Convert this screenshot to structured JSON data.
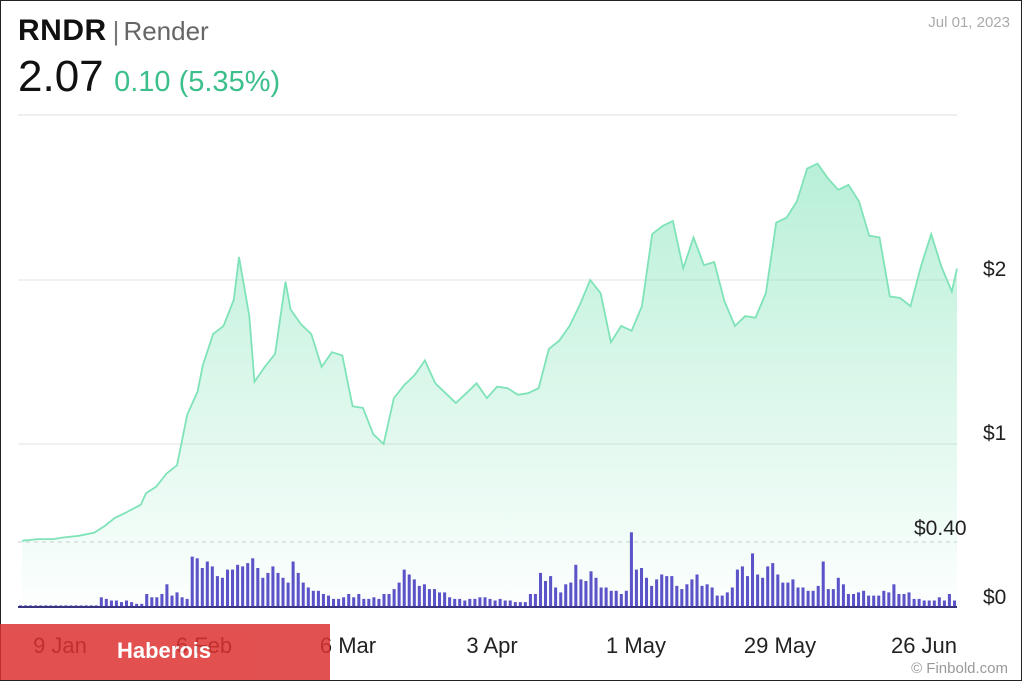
{
  "header": {
    "ticker": "RNDR",
    "separator": "|",
    "name": "Render",
    "price": "2.07",
    "change": "0.10 (5.35%)",
    "date": "Jul 01, 2023"
  },
  "colors": {
    "line": "#7fe3b8",
    "positive_text": "#3cbf8a",
    "volume_bar": "#5b53c8",
    "gridline": "#e3e3e3",
    "watermark": "#dd3232"
  },
  "watermark": "Haberois",
  "credit": "© Finbold.com",
  "chart_data": {
    "type": "area",
    "x_ticks": [
      "9 Jan",
      "6 Feb",
      "6 Mar",
      "3 Apr",
      "1 May",
      "29 May",
      "26 Jun"
    ],
    "price_axis": {
      "ticks": [
        "$2",
        "$1"
      ],
      "tick_values": [
        2,
        1
      ],
      "ylim": [
        0.4,
        2.7
      ]
    },
    "volume_axis": {
      "ticks": [
        "$0.40",
        "$0"
      ]
    },
    "x_range": [
      "2023-01-01",
      "2023-07-01"
    ],
    "series": [
      {
        "values": [
          [
            "2023-01-01",
            0.41
          ],
          [
            "2023-01-04",
            0.42
          ],
          [
            "2023-01-07",
            0.42
          ],
          [
            "2023-01-09",
            0.43
          ],
          [
            "2023-01-12",
            0.44
          ],
          [
            "2023-01-15",
            0.46
          ],
          [
            "2023-01-17",
            0.5
          ],
          [
            "2023-01-19",
            0.55
          ],
          [
            "2023-01-21",
            0.58
          ],
          [
            "2023-01-24",
            0.63
          ],
          [
            "2023-01-25",
            0.7
          ],
          [
            "2023-01-27",
            0.74
          ],
          [
            "2023-01-29",
            0.82
          ],
          [
            "2023-01-31",
            0.87
          ],
          [
            "2023-02-02",
            1.18
          ],
          [
            "2023-02-04",
            1.32
          ],
          [
            "2023-02-05",
            1.48
          ],
          [
            "2023-02-07",
            1.67
          ],
          [
            "2023-02-09",
            1.72
          ],
          [
            "2023-02-11",
            1.88
          ],
          [
            "2023-02-12",
            2.14
          ],
          [
            "2023-02-14",
            1.78
          ],
          [
            "2023-02-15",
            1.38
          ],
          [
            "2023-02-17",
            1.47
          ],
          [
            "2023-02-19",
            1.55
          ],
          [
            "2023-02-21",
            1.99
          ],
          [
            "2023-02-22",
            1.82
          ],
          [
            "2023-02-24",
            1.73
          ],
          [
            "2023-02-26",
            1.67
          ],
          [
            "2023-02-28",
            1.47
          ],
          [
            "2023-03-02",
            1.56
          ],
          [
            "2023-03-04",
            1.54
          ],
          [
            "2023-03-06",
            1.23
          ],
          [
            "2023-03-08",
            1.22
          ],
          [
            "2023-03-10",
            1.06
          ],
          [
            "2023-03-12",
            1.0
          ],
          [
            "2023-03-14",
            1.28
          ],
          [
            "2023-03-16",
            1.36
          ],
          [
            "2023-03-18",
            1.42
          ],
          [
            "2023-03-20",
            1.51
          ],
          [
            "2023-03-22",
            1.37
          ],
          [
            "2023-03-24",
            1.31
          ],
          [
            "2023-03-26",
            1.25
          ],
          [
            "2023-03-28",
            1.31
          ],
          [
            "2023-03-30",
            1.37
          ],
          [
            "2023-04-01",
            1.28
          ],
          [
            "2023-04-03",
            1.35
          ],
          [
            "2023-04-05",
            1.34
          ],
          [
            "2023-04-07",
            1.3
          ],
          [
            "2023-04-09",
            1.31
          ],
          [
            "2023-04-11",
            1.34
          ],
          [
            "2023-04-13",
            1.58
          ],
          [
            "2023-04-15",
            1.63
          ],
          [
            "2023-04-17",
            1.72
          ],
          [
            "2023-04-19",
            1.85
          ],
          [
            "2023-04-21",
            2.0
          ],
          [
            "2023-04-23",
            1.92
          ],
          [
            "2023-04-25",
            1.62
          ],
          [
            "2023-04-27",
            1.72
          ],
          [
            "2023-04-29",
            1.69
          ],
          [
            "2023-05-01",
            1.84
          ],
          [
            "2023-05-03",
            2.28
          ],
          [
            "2023-05-05",
            2.33
          ],
          [
            "2023-05-07",
            2.36
          ],
          [
            "2023-05-09",
            2.07
          ],
          [
            "2023-05-11",
            2.26
          ],
          [
            "2023-05-13",
            2.09
          ],
          [
            "2023-05-15",
            2.11
          ],
          [
            "2023-05-17",
            1.87
          ],
          [
            "2023-05-19",
            1.72
          ],
          [
            "2023-05-21",
            1.78
          ],
          [
            "2023-05-23",
            1.77
          ],
          [
            "2023-05-25",
            1.92
          ],
          [
            "2023-05-27",
            2.35
          ],
          [
            "2023-05-29",
            2.38
          ],
          [
            "2023-05-31",
            2.48
          ],
          [
            "2023-06-02",
            2.68
          ],
          [
            "2023-06-04",
            2.71
          ],
          [
            "2023-06-06",
            2.62
          ],
          [
            "2023-06-08",
            2.55
          ],
          [
            "2023-06-10",
            2.58
          ],
          [
            "2023-06-12",
            2.48
          ],
          [
            "2023-06-14",
            2.27
          ],
          [
            "2023-06-16",
            2.26
          ],
          [
            "2023-06-18",
            1.9
          ],
          [
            "2023-06-20",
            1.89
          ],
          [
            "2023-06-22",
            1.84
          ],
          [
            "2023-06-24",
            2.08
          ],
          [
            "2023-06-26",
            2.28
          ],
          [
            "2023-06-28",
            2.08
          ],
          [
            "2023-06-30",
            1.93
          ],
          [
            "2023-07-01",
            2.07
          ]
        ]
      }
    ],
    "volume": [
      0.01,
      0.01,
      0.01,
      0.01,
      0.01,
      0.01,
      0.01,
      0.01,
      0.01,
      0.01,
      0.01,
      0.01,
      0.01,
      0.01,
      0.01,
      0.01,
      0.06,
      0.05,
      0.04,
      0.04,
      0.03,
      0.04,
      0.03,
      0.02,
      0.02,
      0.08,
      0.06,
      0.06,
      0.08,
      0.14,
      0.07,
      0.09,
      0.06,
      0.05,
      0.31,
      0.3,
      0.24,
      0.28,
      0.25,
      0.19,
      0.18,
      0.23,
      0.23,
      0.26,
      0.25,
      0.27,
      0.3,
      0.24,
      0.18,
      0.21,
      0.25,
      0.21,
      0.18,
      0.15,
      0.28,
      0.21,
      0.15,
      0.12,
      0.1,
      0.1,
      0.08,
      0.07,
      0.05,
      0.05,
      0.06,
      0.08,
      0.06,
      0.08,
      0.05,
      0.05,
      0.06,
      0.05,
      0.08,
      0.08,
      0.11,
      0.15,
      0.23,
      0.2,
      0.17,
      0.13,
      0.14,
      0.11,
      0.11,
      0.09,
      0.09,
      0.06,
      0.05,
      0.05,
      0.04,
      0.05,
      0.05,
      0.06,
      0.06,
      0.05,
      0.04,
      0.05,
      0.04,
      0.04,
      0.03,
      0.03,
      0.03,
      0.08,
      0.08,
      0.21,
      0.16,
      0.19,
      0.12,
      0.09,
      0.14,
      0.15,
      0.26,
      0.17,
      0.16,
      0.22,
      0.18,
      0.12,
      0.12,
      0.1,
      0.1,
      0.08,
      0.1,
      0.46,
      0.23,
      0.24,
      0.18,
      0.13,
      0.17,
      0.2,
      0.19,
      0.19,
      0.13,
      0.11,
      0.14,
      0.17,
      0.2,
      0.13,
      0.14,
      0.12,
      0.07,
      0.07,
      0.09,
      0.12,
      0.23,
      0.25,
      0.19,
      0.33,
      0.2,
      0.18,
      0.25,
      0.27,
      0.2,
      0.15,
      0.15,
      0.17,
      0.12,
      0.12,
      0.1,
      0.1,
      0.13,
      0.28,
      0.11,
      0.11,
      0.18,
      0.14,
      0.08,
      0.08,
      0.09,
      0.1,
      0.07,
      0.07,
      0.07,
      0.1,
      0.09,
      0.14,
      0.08,
      0.08,
      0.09,
      0.05,
      0.05,
      0.04,
      0.04,
      0.04,
      0.06,
      0.04,
      0.08,
      0.04
    ],
    "grid": true,
    "legend": "none"
  }
}
